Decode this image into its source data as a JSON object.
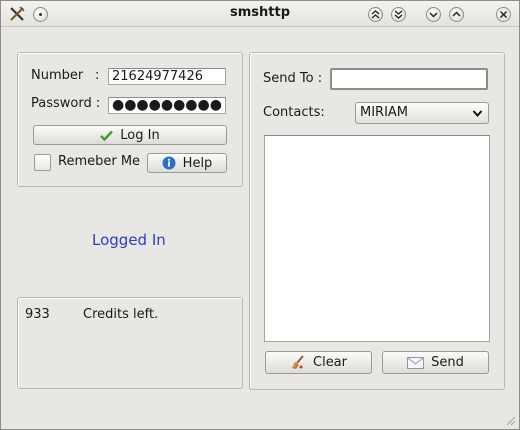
{
  "window": {
    "title": "smshttp"
  },
  "login": {
    "number_label": "Number",
    "number_colon": ":",
    "number_value": "21624977426",
    "password_label": "Password :",
    "password_mask": "●●●●●●●●●",
    "login_button": "Log In",
    "remember_label": "Remeber Me",
    "help_button": "Help"
  },
  "status": {
    "logged_text": "Logged In"
  },
  "credits": {
    "amount": "933",
    "label": "Credits left."
  },
  "send": {
    "send_to_label": "Send To :",
    "send_to_value": "",
    "contacts_label": "Contacts:",
    "contacts_selected": "MIRIAM",
    "clear_button": "Clear",
    "send_button": "Send"
  },
  "icons": {
    "app": "x-tools-icon",
    "menu": "window-menu-icon",
    "shade_up": "shade-up-icon",
    "shade_down": "shade-down-icon",
    "minimize": "minimize-icon",
    "maximize": "maximize-icon",
    "close": "close-icon",
    "login": "checkmark-icon",
    "help": "info-icon",
    "clear": "broom-icon",
    "send": "envelope-icon"
  },
  "colors": {
    "logged_in": "#2a3fbf",
    "checkmark": "#3aa02a",
    "info": "#2a6fd0"
  }
}
